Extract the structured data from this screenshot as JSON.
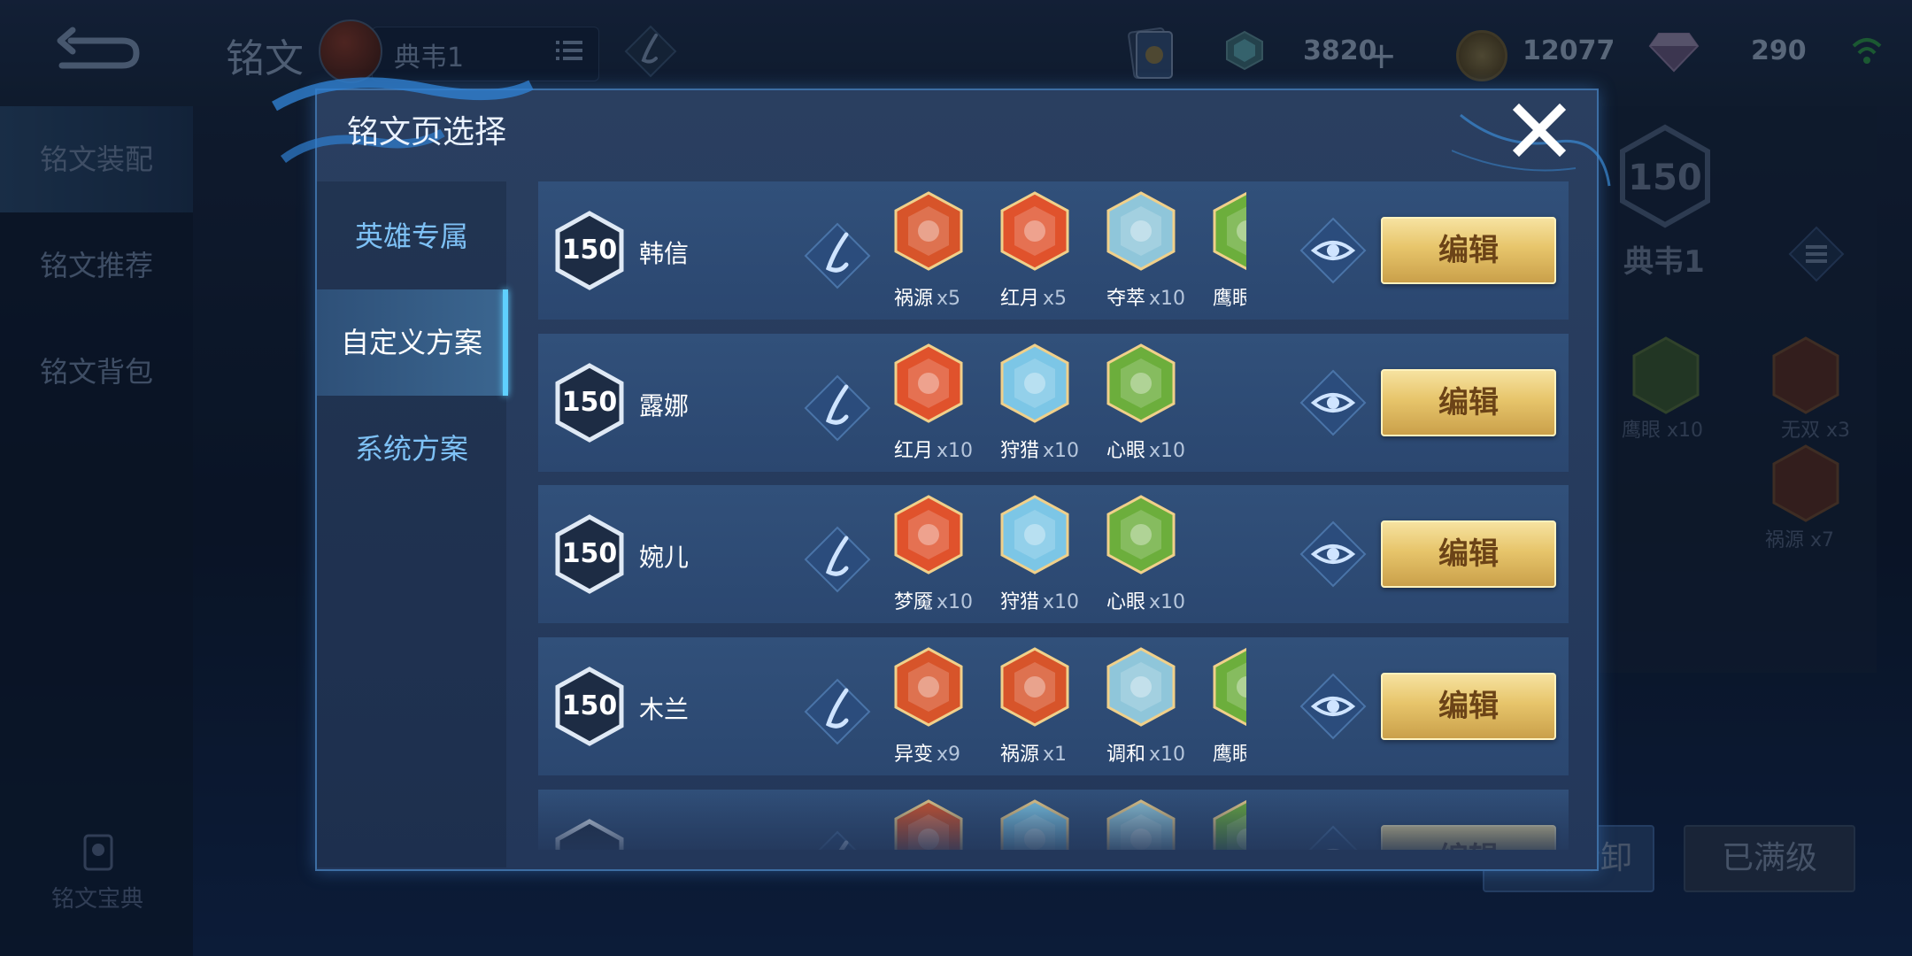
{
  "header": {
    "title": "铭文",
    "current_page": "典韦1",
    "resources": {
      "gems": "3820",
      "gold": "12077",
      "diamonds": "290"
    }
  },
  "left_nav": {
    "items": [
      {
        "label": "铭文装配"
      },
      {
        "label": "铭文推荐"
      },
      {
        "label": "铭文背包"
      }
    ],
    "codex_label": "铭文宝典"
  },
  "right_panel": {
    "level": "150",
    "page_name": "典韦1",
    "runes": [
      {
        "label": "鹰眼 x10"
      },
      {
        "label": "无双 x3"
      },
      {
        "label": "祸源 x7"
      }
    ],
    "buttons": {
      "unload": "一键拆卸",
      "maxed": "已满级"
    }
  },
  "modal": {
    "title": "铭文页选择",
    "tabs": [
      {
        "label": "英雄专属"
      },
      {
        "label": "自定义方案"
      },
      {
        "label": "系统方案"
      }
    ],
    "active_tab": "自定义方案",
    "edit_label": "编辑",
    "rows": [
      {
        "level": "150",
        "hero": "韩信",
        "runes": [
          {
            "name": "祸源",
            "count": "x5",
            "color": "#d7542a"
          },
          {
            "name": "红月",
            "count": "x5",
            "color": "#e0522c"
          },
          {
            "name": "夺萃",
            "count": "x10",
            "color": "#8fc6da"
          },
          {
            "name": "鹰眼",
            "count": "",
            "color": "#6cae3c"
          }
        ]
      },
      {
        "level": "150",
        "hero": "露娜",
        "runes": [
          {
            "name": "红月",
            "count": "x10",
            "color": "#e0522c"
          },
          {
            "name": "狩猎",
            "count": "x10",
            "color": "#7cc6e6"
          },
          {
            "name": "心眼",
            "count": "x10",
            "color": "#6cae3c"
          }
        ]
      },
      {
        "level": "150",
        "hero": "婉儿",
        "runes": [
          {
            "name": "梦魇",
            "count": "x10",
            "color": "#e0522c"
          },
          {
            "name": "狩猎",
            "count": "x10",
            "color": "#7cc6e6"
          },
          {
            "name": "心眼",
            "count": "x10",
            "color": "#6cae3c"
          }
        ]
      },
      {
        "level": "150",
        "hero": "木兰",
        "runes": [
          {
            "name": "异变",
            "count": "x9",
            "color": "#d7542a"
          },
          {
            "name": "祸源",
            "count": "x1",
            "color": "#d7542a"
          },
          {
            "name": "调和",
            "count": "x10",
            "color": "#8fc6da"
          },
          {
            "name": "鹰眼",
            "count": "",
            "color": "#6cae3c"
          }
        ]
      },
      {
        "level": "",
        "hero": "",
        "runes": [
          {
            "name": "",
            "count": "",
            "color": "#d7542a"
          },
          {
            "name": "",
            "count": "",
            "color": "#7cc6e6"
          },
          {
            "name": "",
            "count": "",
            "color": "#8fc6da"
          },
          {
            "name": "",
            "count": "",
            "color": "#6cae3c"
          }
        ]
      }
    ]
  }
}
